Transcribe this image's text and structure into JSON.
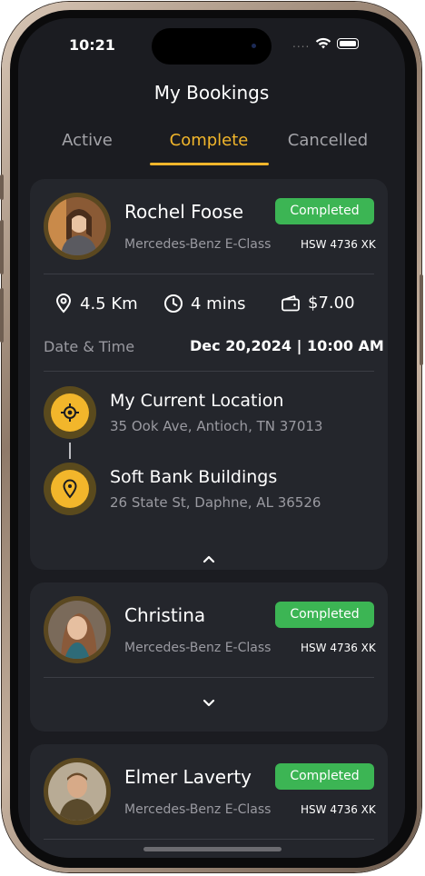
{
  "status_bar": {
    "time": "10:21",
    "signal": "....",
    "icons": [
      "wifi-icon",
      "battery-icon"
    ]
  },
  "header": {
    "title": "My Bookings"
  },
  "tabs": [
    {
      "label": "Active",
      "active": false
    },
    {
      "label": "Complete",
      "active": true
    },
    {
      "label": "Cancelled",
      "active": false
    }
  ],
  "bookings": [
    {
      "name": "Rochel Foose",
      "status": "Completed",
      "car": "Mercedes-Benz E-Class",
      "plate": "HSW 4736 XK",
      "expanded": true,
      "distance": "4.5 Km",
      "duration": "4 mins",
      "price": "$7.00",
      "datetime_label": "Date & Time",
      "datetime_value": "Dec 20,2024 | 10:00 AM",
      "pickup": {
        "title": "My Current Location",
        "address": "35 Ook Ave, Antioch, TN 37013"
      },
      "dropoff": {
        "title": "Soft Bank Buildings",
        "address": "26 State St, Daphne, AL 36526"
      }
    },
    {
      "name": "Christina",
      "status": "Completed",
      "car": "Mercedes-Benz E-Class",
      "plate": "HSW 4736 XK",
      "expanded": false
    },
    {
      "name": "Elmer Laverty",
      "status": "Completed",
      "car": "Mercedes-Benz E-Class",
      "plate": "HSW 4736 XK",
      "expanded": false
    }
  ],
  "colors": {
    "accent": "#f2b62b",
    "badge": "#3cb554",
    "background": "#1b1c21",
    "card": "#24262c"
  }
}
